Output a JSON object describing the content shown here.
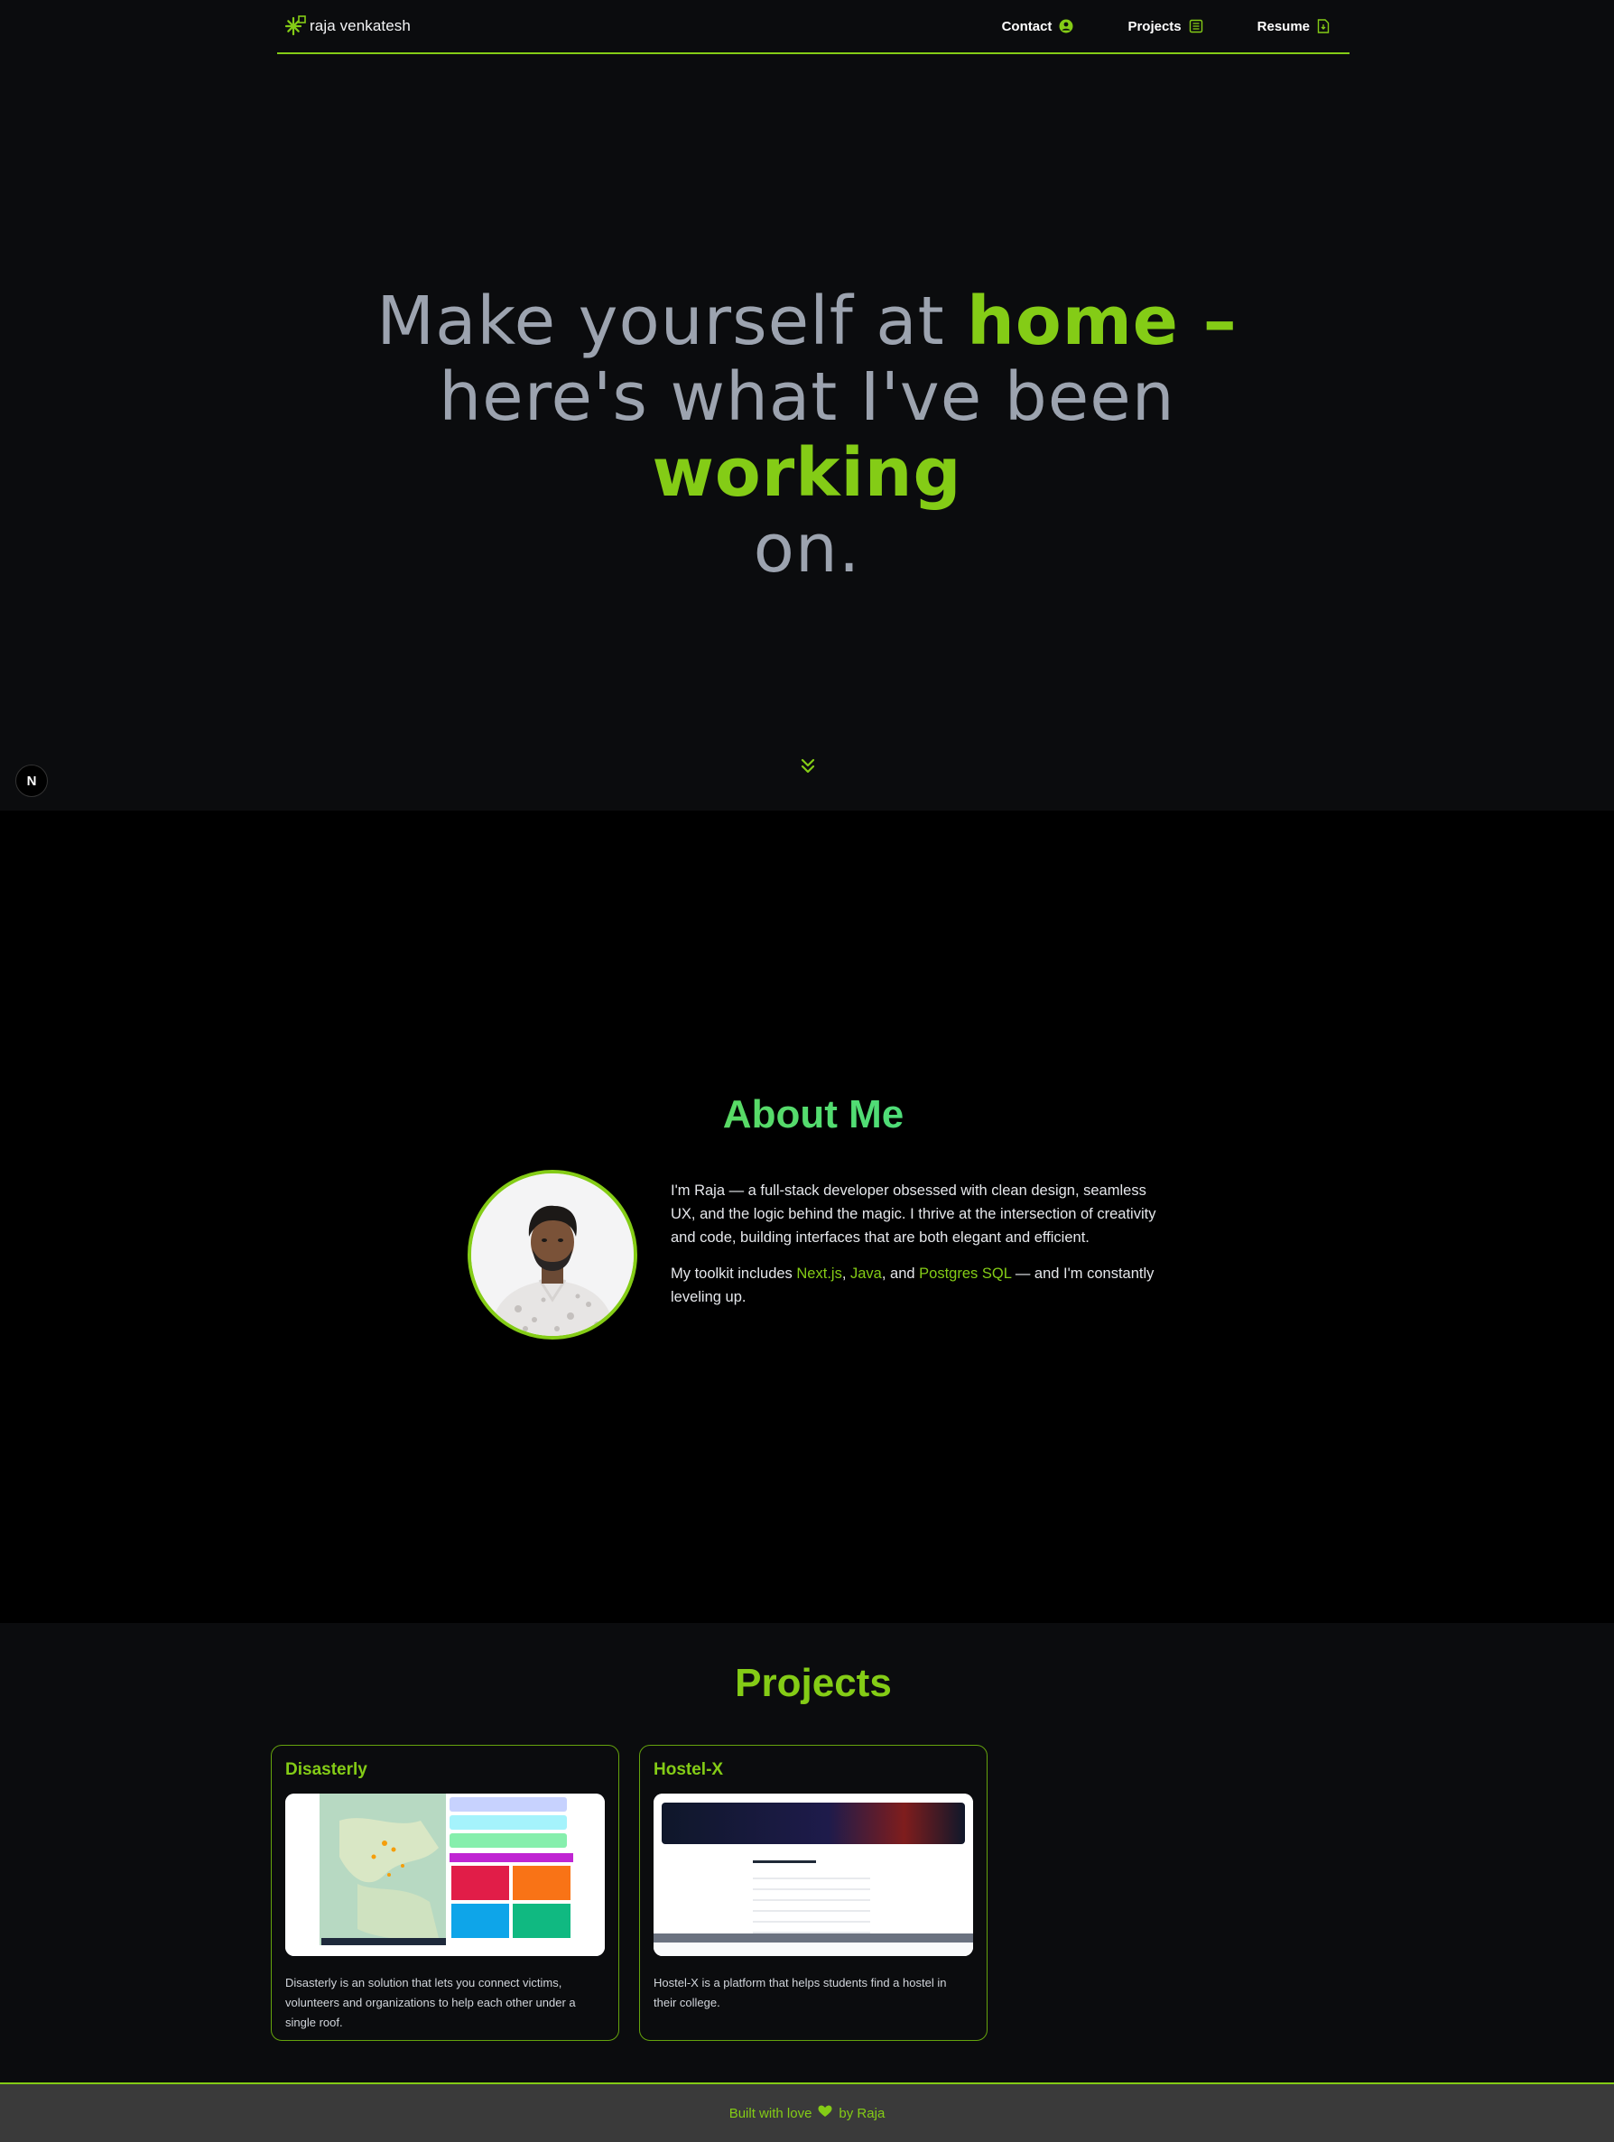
{
  "nav": {
    "brand_name": "raja venkatesh",
    "brand_icon": "asterisk-logo-icon",
    "links": [
      {
        "label": "Contact",
        "icon": "user-circle-icon"
      },
      {
        "label": "Projects",
        "icon": "list-doc-icon"
      },
      {
        "label": "Resume",
        "icon": "file-icon"
      }
    ]
  },
  "hero": {
    "line1_a": "Make yourself at ",
    "line1_b": "home –",
    "line2_a": "here's what I've been ",
    "line2_b": "working",
    "line3": "on.",
    "scroll_icon": "chevrons-down-icon",
    "next_badge": "N"
  },
  "about": {
    "title": "About Me",
    "para1": "I'm Raja — a full-stack developer obsessed with clean design, seamless UX, and the logic behind the magic. I thrive at the intersection of creativity and code, building interfaces that are both elegant and efficient.",
    "para2_a": "My toolkit includes ",
    "tech1": "Next.js",
    "sep1": ", ",
    "tech2": "Java",
    "sep2": ", and ",
    "tech3": "Postgres SQL",
    "para2_b": " — and I'm constantly leveling up."
  },
  "projects": {
    "title": "Projects",
    "items": [
      {
        "title": "Disasterly",
        "description": "Disasterly is an solution that lets you connect victims, volunteers and organizations to help each other under a single roof."
      },
      {
        "title": "Hostel-X",
        "description": "Hostel-X is a platform that helps students find a hostel in their college."
      }
    ]
  },
  "footer": {
    "text_a": "Built with love",
    "heart_icon": "heart-icon",
    "text_b": "by Raja"
  },
  "colors": {
    "accent": "#84cc16",
    "background": "#0b0c0e",
    "about_background": "#000000",
    "footer_background": "#3a3a3a"
  }
}
